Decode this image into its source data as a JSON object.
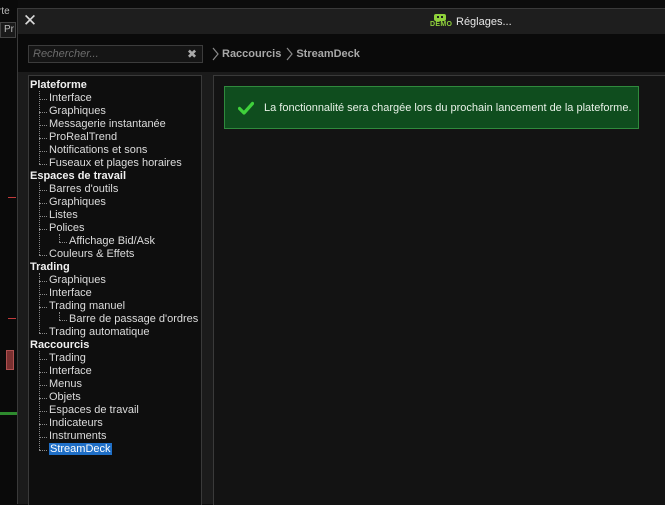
{
  "background": {
    "tab_text_1": "rte",
    "tab_text_2": "Pr"
  },
  "window": {
    "title": "Réglages...",
    "badge": "DEMO",
    "close_glyph": "✕"
  },
  "search": {
    "placeholder": "Rechercher...",
    "value": "",
    "clear_glyph": "✖"
  },
  "breadcrumb": [
    "Raccourcis",
    "StreamDeck"
  ],
  "tree": {
    "groups": [
      {
        "label": "Plateforme",
        "items": [
          {
            "label": "Interface"
          },
          {
            "label": "Graphiques"
          },
          {
            "label": "Messagerie instantanée"
          },
          {
            "label": "ProRealTrend"
          },
          {
            "label": "Notifications et sons"
          },
          {
            "label": "Fuseaux et plages horaires"
          }
        ]
      },
      {
        "label": "Espaces de travail",
        "items": [
          {
            "label": "Barres d'outils"
          },
          {
            "label": "Graphiques"
          },
          {
            "label": "Listes"
          },
          {
            "label": "Polices",
            "children": [
              "Affichage Bid/Ask"
            ]
          },
          {
            "label": "Couleurs & Effets"
          }
        ]
      },
      {
        "label": "Trading",
        "items": [
          {
            "label": "Graphiques"
          },
          {
            "label": "Interface"
          },
          {
            "label": "Trading manuel",
            "children": [
              "Barre de passage d'ordres"
            ]
          },
          {
            "label": "Trading automatique"
          }
        ]
      },
      {
        "label": "Raccourcis",
        "items": [
          {
            "label": "Trading"
          },
          {
            "label": "Interface"
          },
          {
            "label": "Menus"
          },
          {
            "label": "Objets"
          },
          {
            "label": "Espaces de travail"
          },
          {
            "label": "Indicateurs"
          },
          {
            "label": "Instruments"
          },
          {
            "label": "StreamDeck",
            "selected": true
          }
        ]
      }
    ]
  },
  "notice": {
    "text": "La fonctionnalité sera chargée lors du prochain lancement de la plateforme.",
    "icon": "checkmark-icon"
  },
  "colors": {
    "accent_green": "#8fd13b",
    "notice_bg": "#0f4d1e",
    "selection": "#1f6fc7"
  }
}
